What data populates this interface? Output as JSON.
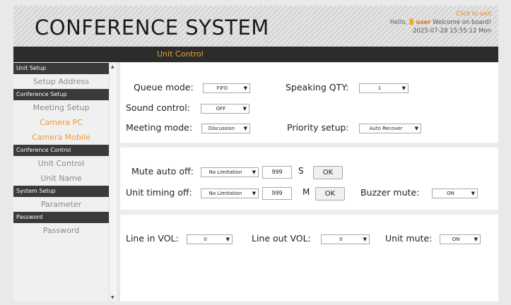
{
  "header": {
    "title": "CONFERENCE SYSTEM",
    "exit_label": "Click to exit",
    "greeting_prefix": "Hello,",
    "user_name": "user",
    "welcome": "Welcome on board!",
    "datetime": "2025-07-28 15:55:12 Mon"
  },
  "navbar": {
    "title": "Unit Control"
  },
  "sidebar": {
    "sections": [
      {
        "label": "Unit Setup",
        "items": [
          "Setup Address"
        ]
      },
      {
        "label": "Conference Setup",
        "items": [
          "Meeting Setup",
          "Camera PC",
          "Camera Mobile"
        ]
      },
      {
        "label": "Conference Control",
        "items": [
          "Unit Control",
          "Unit Name"
        ]
      },
      {
        "label": "System Setup",
        "items": [
          "Parameter"
        ]
      },
      {
        "label": "Password",
        "items": [
          "Password"
        ]
      }
    ],
    "highlight_color": "#ec9a3a"
  },
  "main": {
    "queue_mode": {
      "label": "Queue mode:",
      "value": "FIFO"
    },
    "speaking_qty": {
      "label": "Speaking QTY:",
      "value": "1"
    },
    "sound_control": {
      "label": "Sound control:",
      "value": "OFF"
    },
    "meeting_mode": {
      "label": "Meeting mode:",
      "value": "Discussion"
    },
    "priority_setup": {
      "label": "Priority setup:",
      "value": "Auto Recover"
    },
    "mute_auto_off": {
      "label": "Mute auto off:",
      "select": "No Limitation",
      "input": "999",
      "unit": "S",
      "button": "OK"
    },
    "unit_timing_off": {
      "label": "Unit timing off:",
      "select": "No Limitation",
      "input": "999",
      "unit": "M",
      "button": "OK"
    },
    "buzzer_mute": {
      "label": "Buzzer mute:",
      "value": "ON"
    },
    "line_in_vol": {
      "label": "Line in VOL:",
      "value": "0"
    },
    "line_out_vol": {
      "label": "Line out VOL:",
      "value": "0"
    },
    "unit_mute": {
      "label": "Unit mute:",
      "value": "ON"
    }
  }
}
